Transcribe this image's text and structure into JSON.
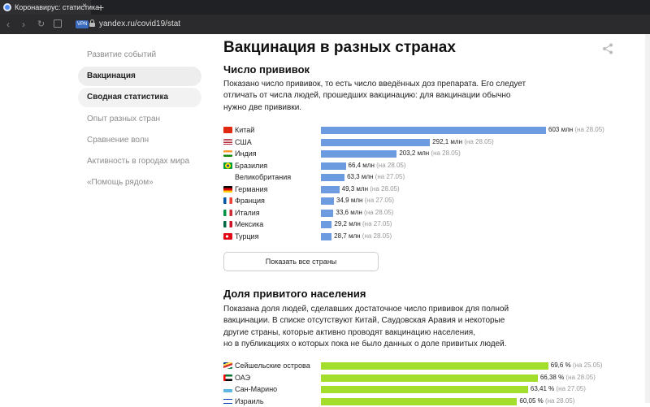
{
  "browser": {
    "tab_title": "Коронавирус: статистика",
    "tab_close": "×",
    "new_tab": "+",
    "vpn": "VPN",
    "url": "yandex.ru/covid19/stat"
  },
  "sidebar": {
    "items": [
      {
        "label": "Развитие событий",
        "state": "normal"
      },
      {
        "label": "Вакцинация",
        "state": "active"
      },
      {
        "label": "Сводная статистика",
        "state": "hover"
      },
      {
        "label": "Опыт разных стран",
        "state": "normal"
      },
      {
        "label": "Сравнение волн",
        "state": "normal"
      },
      {
        "label": "Активность в городах мира",
        "state": "normal"
      },
      {
        "label": "«Помощь рядом»",
        "state": "normal"
      }
    ]
  },
  "page": {
    "title": "Вакцинация в разных странах"
  },
  "doses": {
    "title": "Число прививок",
    "description": [
      "Показано число прививок, то есть число введённых доз препарата. Его следует",
      "отличать от числа людей, прошедших вакцинацию: для вакцинации обычно",
      "нужно две прививки."
    ],
    "max_value": 603,
    "rows": [
      {
        "country": "Китай",
        "value": 603,
        "value_label": "603 млн",
        "date": "(на 28.05)",
        "flag": "china"
      },
      {
        "country": "США",
        "value": 292.1,
        "value_label": "292,1 млн",
        "date": "(на 28.05)",
        "flag": "usa"
      },
      {
        "country": "Индия",
        "value": 203.2,
        "value_label": "203,2 млн",
        "date": "(на 28.05)",
        "flag": "india"
      },
      {
        "country": "Бразилия",
        "value": 66.4,
        "value_label": "66,4 млн",
        "date": "(на 28.05)",
        "flag": "brazil"
      },
      {
        "country": "Великобритания",
        "value": 63.3,
        "value_label": "63,3 млн",
        "date": "(на 27.05)",
        "flag": "uk"
      },
      {
        "country": "Германия",
        "value": 49.3,
        "value_label": "49,3 млн",
        "date": "(на 28.05)",
        "flag": "germany"
      },
      {
        "country": "Франция",
        "value": 34.9,
        "value_label": "34,9 млн",
        "date": "(на 27.05)",
        "flag": "france"
      },
      {
        "country": "Италия",
        "value": 33.6,
        "value_label": "33,6 млн",
        "date": "(на 28.05)",
        "flag": "italy"
      },
      {
        "country": "Мексика",
        "value": 29.2,
        "value_label": "29,2 млн",
        "date": "(на 27.05)",
        "flag": "mexico"
      },
      {
        "country": "Турция",
        "value": 28.7,
        "value_label": "28,7 млн",
        "date": "(на 28.05)",
        "flag": "turkey"
      }
    ],
    "show_all_button": "Показать все страны"
  },
  "share_of_population": {
    "title": "Доля привитого населения",
    "description": [
      "Показана доля людей, сделавших достаточное число прививок для полной",
      "вакцинации. В списке отсутствуют Китай, Саудовская Аравия и некоторые",
      "другие страны, которые активно проводят вакцинацию населения,",
      "но в публикациях о которых пока не было данных о доле привитых людей."
    ],
    "rows": [
      {
        "country": "Сейшельские острова",
        "value": 69.6,
        "value_label": "69,6 %",
        "date": "(на 25.05)",
        "flag": "seychelles"
      },
      {
        "country": "ОАЭ",
        "value": 66.38,
        "value_label": "66,38 %",
        "date": "(на 28.05)",
        "flag": "uae"
      },
      {
        "country": "Сан-Марино",
        "value": 63.41,
        "value_label": "63,41 %",
        "date": "(на 27.05)",
        "flag": "sanmarino"
      },
      {
        "country": "Израиль",
        "value": 60.05,
        "value_label": "60,05 %",
        "date": "(на 28.05)",
        "flag": "israel"
      }
    ]
  },
  "colors": {
    "doses_bar": "#6d9be0",
    "share_bar": "#a4de2c",
    "active_nav_bg": "#ededed"
  }
}
